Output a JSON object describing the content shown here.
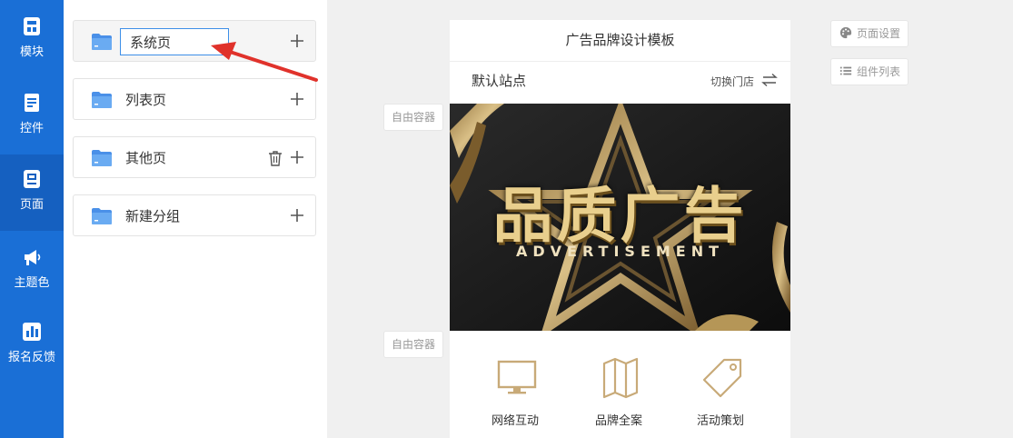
{
  "nav": {
    "items": [
      {
        "label": "模块",
        "icon": "module-icon"
      },
      {
        "label": "控件",
        "icon": "widget-icon"
      },
      {
        "label": "页面",
        "icon": "page-icon",
        "active": true
      },
      {
        "label": "主题色",
        "icon": "megaphone-icon"
      },
      {
        "label": "报名反馈",
        "icon": "chart-bars-icon"
      }
    ]
  },
  "groups": {
    "editing_value": "系统页",
    "items": [
      {
        "label": "系统页"
      },
      {
        "label": "列表页"
      },
      {
        "label": "其他页"
      },
      {
        "label": "新建分组"
      }
    ]
  },
  "canvas": {
    "free_container_label": "自由容器",
    "page_settings_label": "页面设置",
    "component_list_label": "组件列表"
  },
  "phone": {
    "title": "广告品牌设计模板",
    "site_name": "默认站点",
    "switch_store": "切换门店",
    "banner": {
      "title": "品质广告",
      "subtitle": "ADVERTISEMENT"
    },
    "icons": [
      {
        "label": "网络互动",
        "icon": "monitor-icon"
      },
      {
        "label": "品牌全案",
        "icon": "map-icon"
      },
      {
        "label": "活动策划",
        "icon": "tag-icon"
      }
    ]
  },
  "colors": {
    "nav_bg": "#1a6fd6",
    "nav_active": "#1560c0",
    "accent_blue": "#3d8fe8",
    "gold": "#c8aa78",
    "arrow_red": "#e0322b"
  }
}
